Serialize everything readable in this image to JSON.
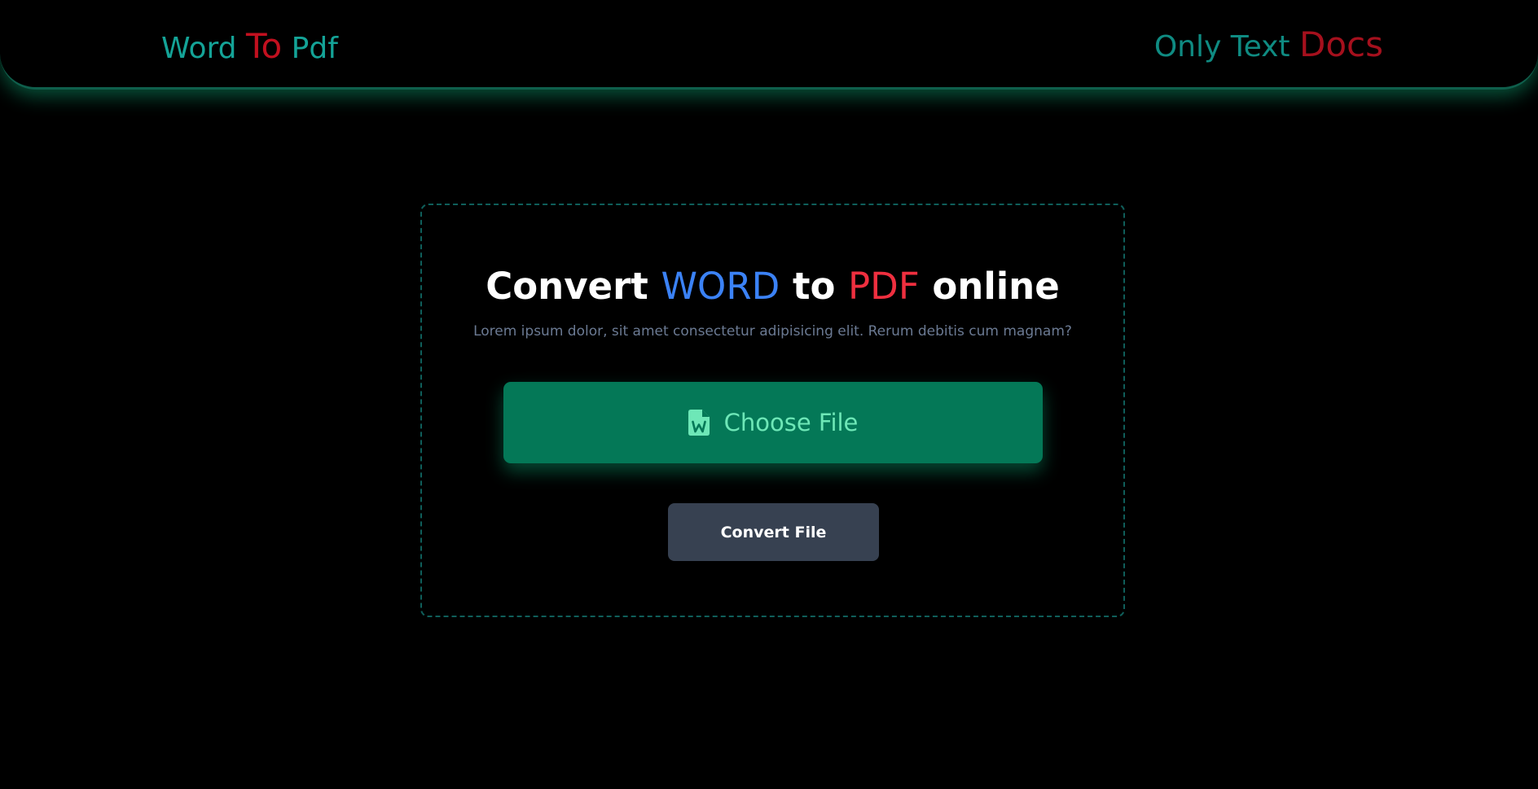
{
  "navbar": {
    "brand": {
      "part1": "Word ",
      "accent": "To",
      "part2": " Pdf"
    },
    "right": {
      "part1": "Only Text ",
      "accent": "Docs"
    }
  },
  "main": {
    "title": {
      "part1": "Convert ",
      "word": "WORD",
      "part2": " to ",
      "pdf": "PDF",
      "part3": " online"
    },
    "subtitle": "Lorem ipsum dolor, sit amet consectetur adipisicing elit. Rerum debitis cum magnam?",
    "choose_button": {
      "icon": "word-file-icon",
      "label": "Choose File"
    },
    "convert_button": {
      "label": "Convert File"
    }
  },
  "colors": {
    "background": "#000000",
    "brand_teal": "#14a397",
    "brand_red": "#c2101f",
    "word_blue": "#3b82f6",
    "pdf_red": "#ef2f3f",
    "choose_button_bg": "#047857",
    "choose_button_text": "#6ee7b7",
    "convert_button_bg": "#374151"
  }
}
